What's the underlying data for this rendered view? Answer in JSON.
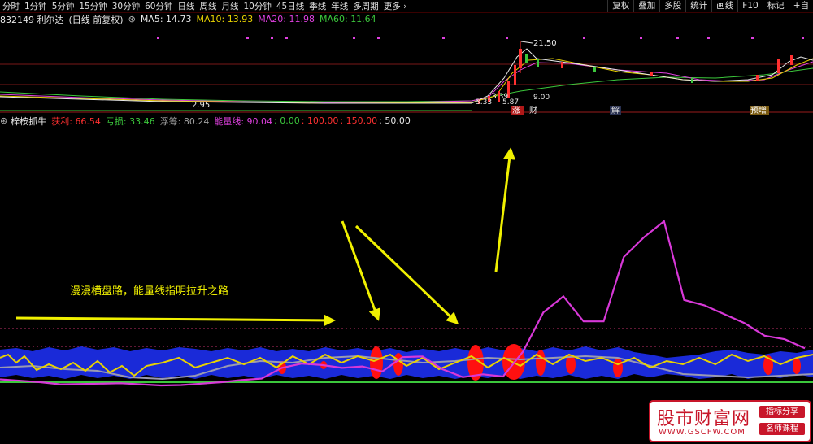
{
  "toolbar": {
    "periods": [
      "分时",
      "1分钟",
      "5分钟",
      "15分钟",
      "30分钟",
      "60分钟",
      "日线",
      "周线",
      "月线",
      "10分钟",
      "45日线",
      "季线",
      "年线",
      "多周期",
      "更多"
    ],
    "right_buttons": [
      "复权",
      "叠加",
      "多股",
      "统计",
      "画线",
      "F10",
      "标记",
      "+自"
    ]
  },
  "stock": {
    "code_name": "832149 利尔达",
    "period_label": "(日线 前复权)"
  },
  "ma": [
    {
      "label": "MA5: ",
      "value": "14.73",
      "color": "#e8e8e8"
    },
    {
      "label": "MA10: ",
      "value": "13.93",
      "color": "#e8d200"
    },
    {
      "label": "MA20: ",
      "value": "11.98",
      "color": "#e040e0"
    },
    {
      "label": "MA60: ",
      "value": "11.64",
      "color": "#3cc83c"
    }
  ],
  "price_labels": {
    "high": "21.50",
    "low": "2.95",
    "mid1": "3.39",
    "mid2": "5.87",
    "mid3": "3.33",
    "mid4": "9.00"
  },
  "event_tags": [
    "涨",
    "财",
    "解",
    "预增"
  ],
  "indicator": {
    "name": "梓桉抓牛",
    "items": [
      {
        "label": "获利: ",
        "value": "66.54",
        "color": "#ff3030"
      },
      {
        "label": "亏损: ",
        "value": "33.46",
        "color": "#3cc83c"
      },
      {
        "label": "浮筹: ",
        "value": "80.24",
        "color": "#a0a0a0"
      },
      {
        "label": "能量线: ",
        "value": "90.04",
        "color": "#e040e0"
      },
      {
        "label": ": ",
        "value": "0.00",
        "color": "#3cc83c"
      },
      {
        "label": ": ",
        "value": "100.00",
        "color": "#ff3030"
      },
      {
        "label": ": ",
        "value": "150.00",
        "color": "#ff3030"
      },
      {
        "label": ": ",
        "value": "50.00",
        "color": "#e8e8e8"
      }
    ]
  },
  "annotation": "漫漫横盘路，能量线指明拉升之路",
  "watermark": {
    "title": "股市财富网",
    "url": "WWW.GSCFW.COM",
    "tag1": "指标分享",
    "tag2": "名师课程"
  },
  "chart_data": {
    "type": "line",
    "x": [
      0,
      1,
      2,
      3,
      4,
      5,
      6,
      7,
      8,
      9,
      10,
      11,
      12,
      13,
      14,
      15,
      16,
      17,
      18,
      19,
      20,
      21,
      22,
      23,
      24,
      25,
      26,
      27,
      28,
      29,
      30,
      31,
      32,
      33,
      34,
      35,
      36,
      37,
      38,
      39,
      40
    ],
    "series": [
      {
        "name": "能量线",
        "values": [
          8,
          4,
          0,
          -6,
          -5,
          -4,
          -3,
          -6,
          -9,
          -8,
          -4,
          0,
          6,
          10,
          40,
          52,
          48,
          40,
          44,
          30,
          70,
          72,
          36,
          14,
          22,
          16,
          86,
          195,
          240,
          170,
          170,
          350,
          405,
          450,
          230,
          215,
          190,
          165,
          130,
          120,
          95
        ]
      }
    ]
  }
}
